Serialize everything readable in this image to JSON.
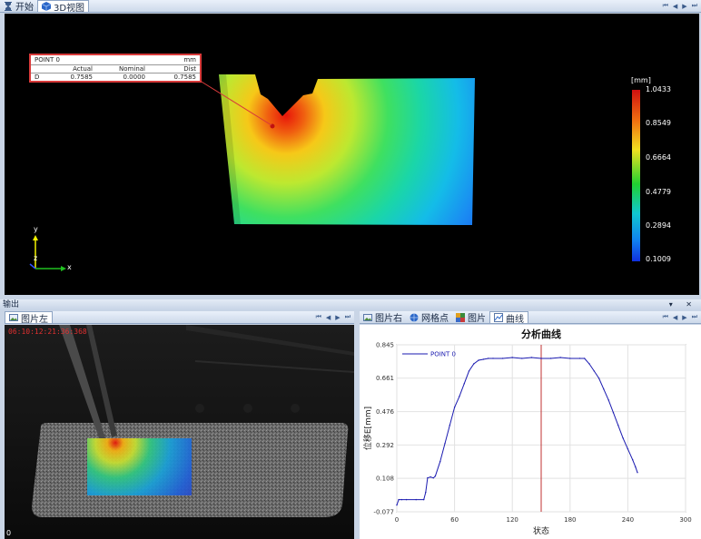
{
  "top_tabs": [
    {
      "label": "开始",
      "icon": "hourglass-icon"
    },
    {
      "label": "3D视图",
      "icon": "cube-icon"
    }
  ],
  "nav_glyphs": [
    "⏮",
    "◀",
    "▶",
    "⏭"
  ],
  "view3d": {
    "callout": {
      "point": "POINT 0",
      "unit": "mm",
      "headers": [
        "Actual",
        "Nominal",
        "Dist"
      ],
      "row_label": "D",
      "values": [
        "0.7585",
        "0.0000",
        "0.7585"
      ]
    },
    "legend": {
      "unit": "[mm]",
      "ticks": [
        "1.0433",
        "0.8549",
        "0.6664",
        "0.4779",
        "0.2894",
        "0.1009"
      ]
    },
    "axes": {
      "y": "y",
      "z": "z",
      "x": "x"
    }
  },
  "output_bar": {
    "label": "输出",
    "controls": "▾ ✕"
  },
  "left_panel": {
    "tab": "图片左",
    "timestamp": "06:10:12:21:36:368",
    "frame": "0"
  },
  "right_panel": {
    "tabs": [
      {
        "label": "图片右",
        "icon": "picture-icon"
      },
      {
        "label": "网格点",
        "icon": "globe-icon"
      },
      {
        "label": "图片",
        "icon": "image-icon"
      },
      {
        "label": "曲线",
        "icon": "curve-icon"
      }
    ]
  },
  "chart_data": {
    "type": "line",
    "title": "分析曲线",
    "xlabel": "状态",
    "ylabel": "位移E[mm]",
    "xlim": [
      0,
      300
    ],
    "ylim": [
      -0.077,
      0.845
    ],
    "xticks": [
      0,
      60,
      120,
      180,
      240,
      300
    ],
    "yticks": [
      "0.845",
      "0.661",
      "0.476",
      "0.292",
      "0.108",
      "-0.077"
    ],
    "legend": "top-left",
    "grid": true,
    "marker_x": 150,
    "series": [
      {
        "name": "POINT 0",
        "color": "#1a1ab0",
        "x": [
          0,
          2,
          5,
          10,
          20,
          28,
          30,
          32,
          35,
          38,
          40,
          45,
          50,
          55,
          60,
          65,
          70,
          75,
          80,
          85,
          90,
          95,
          100,
          110,
          120,
          130,
          140,
          150,
          160,
          170,
          180,
          190,
          195,
          200,
          205,
          210,
          215,
          220,
          225,
          230,
          235,
          240,
          245,
          248,
          250
        ],
        "y": [
          -0.04,
          -0.01,
          -0.01,
          -0.01,
          -0.01,
          -0.01,
          0.03,
          0.11,
          0.115,
          0.11,
          0.12,
          0.2,
          0.3,
          0.4,
          0.5,
          0.56,
          0.63,
          0.7,
          0.74,
          0.76,
          0.765,
          0.77,
          0.77,
          0.77,
          0.775,
          0.77,
          0.775,
          0.77,
          0.77,
          0.775,
          0.77,
          0.77,
          0.77,
          0.74,
          0.7,
          0.66,
          0.6,
          0.54,
          0.47,
          0.4,
          0.33,
          0.27,
          0.21,
          0.17,
          0.14
        ]
      }
    ]
  }
}
